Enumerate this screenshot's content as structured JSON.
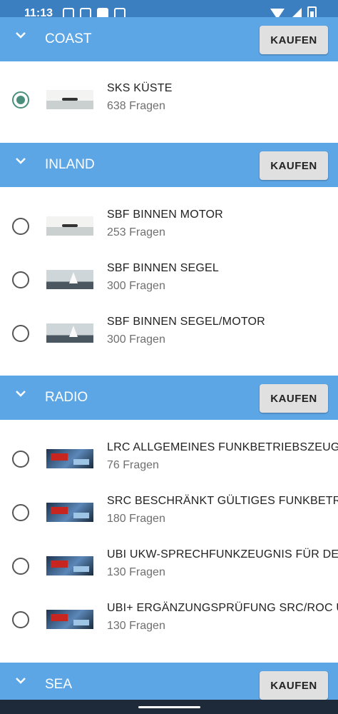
{
  "status_bar": {
    "time": "11:13",
    "icons": [
      "news-icon",
      "s-app-icon",
      "shop-icon",
      "gif-app-icon"
    ]
  },
  "sections": [
    {
      "title": "COAST",
      "buy_label": "KAUFEN",
      "items": [
        {
          "title": "SKS KÜSTE",
          "subtitle": "638 Fragen",
          "selected": true,
          "thumb": "boat"
        }
      ]
    },
    {
      "title": "INLAND",
      "buy_label": "KAUFEN",
      "items": [
        {
          "title": "SBF BINNEN MOTOR",
          "subtitle": "253 Fragen",
          "selected": false,
          "thumb": "boat"
        },
        {
          "title": "SBF BINNEN SEGEL",
          "subtitle": "300 Fragen",
          "selected": false,
          "thumb": "sail"
        },
        {
          "title": "SBF BINNEN SEGEL/MOTOR",
          "subtitle": "300 Fragen",
          "selected": false,
          "thumb": "sail"
        }
      ]
    },
    {
      "title": "RADIO",
      "buy_label": "KAUFEN",
      "items": [
        {
          "title": "LRC ALLGEMEINES FUNKBETRIEBSZEUGNI",
          "subtitle": "76 Fragen",
          "selected": false,
          "thumb": "radio"
        },
        {
          "title": "SRC BESCHRÄNKT GÜLTIGES FUNKBETRI",
          "subtitle": "180 Fragen",
          "selected": false,
          "thumb": "radio"
        },
        {
          "title": "UBI UKW-SPRECHFUNKZEUGNIS FÜR DEN",
          "subtitle": "130 Fragen",
          "selected": false,
          "thumb": "radio"
        },
        {
          "title": "UBI+ ERGÄNZUNGSPRÜFUNG SRC/ROC U",
          "subtitle": "130 Fragen",
          "selected": false,
          "thumb": "radio"
        }
      ]
    },
    {
      "title": "SEA",
      "buy_label": "KAUFEN",
      "items": []
    }
  ],
  "colors": {
    "status_bar": "#3b7fc1",
    "header": "#5da6e6",
    "radio_selected": "#4a8f7c"
  }
}
